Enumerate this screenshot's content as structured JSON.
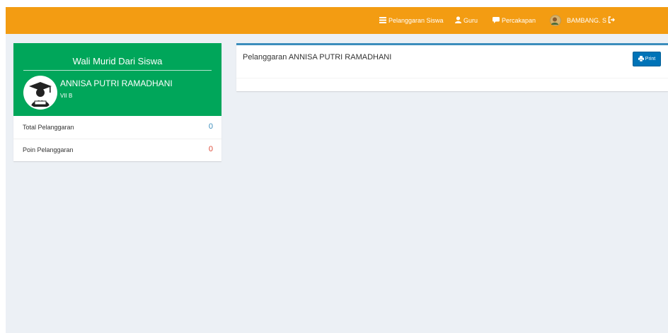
{
  "nav": {
    "pelanggaran_label": "Pelanggaran Siswa",
    "guru_label": "Guru",
    "percakapan_label": "Percakapan",
    "user_label": "BAMBANG. S"
  },
  "profile": {
    "title": "Wali Murid Dari Siswa",
    "name": "ANNISA PUTRI RAMADHANI",
    "class": "VII B",
    "stats": [
      {
        "label": "Total Pelanggaran",
        "value": "0",
        "color": "#3c8dbc"
      },
      {
        "label": "Poin Pelanggaran",
        "value": "0",
        "color": "#dd4b39"
      }
    ]
  },
  "main": {
    "title": "Pelanggaran ANNISA PUTRI RAMADHANI",
    "print_label": "Print"
  },
  "colors": {
    "topbar": "#f39c12",
    "profile_header": "#00a65a",
    "print_button": "#0073b7"
  },
  "icons": [
    "list-icon",
    "user-icon",
    "comment-icon",
    "avatar",
    "sign-out-icon",
    "graduate-avatar",
    "print-icon"
  ]
}
